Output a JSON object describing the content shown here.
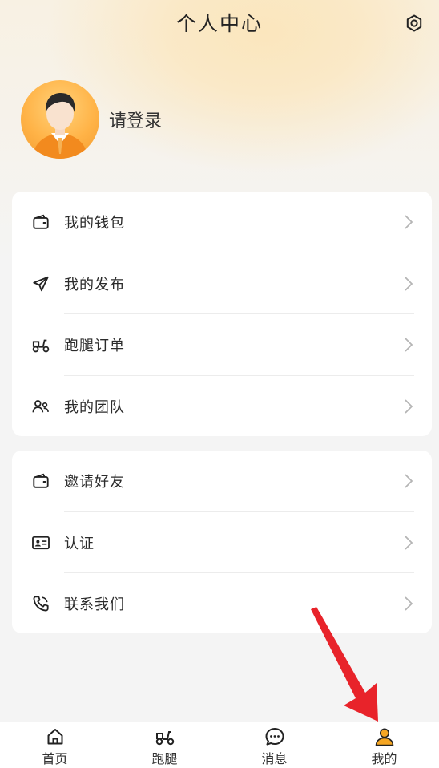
{
  "header": {
    "title": "个人中心",
    "settings_icon": "settings-icon"
  },
  "profile": {
    "login_text": "请登录",
    "avatar_icon": "user-avatar"
  },
  "menu_group1": [
    {
      "label": "我的钱包",
      "icon": "wallet-icon"
    },
    {
      "label": "我的发布",
      "icon": "send-icon"
    },
    {
      "label": "跑腿订单",
      "icon": "scooter-icon"
    },
    {
      "label": "我的团队",
      "icon": "team-icon"
    }
  ],
  "menu_group2": [
    {
      "label": "邀请好友",
      "icon": "wallet-icon"
    },
    {
      "label": "认证",
      "icon": "id-card-icon"
    },
    {
      "label": "联系我们",
      "icon": "phone-icon"
    }
  ],
  "tabbar": [
    {
      "label": "首页",
      "icon": "home-icon",
      "active": false
    },
    {
      "label": "跑腿",
      "icon": "scooter-icon",
      "active": false
    },
    {
      "label": "消息",
      "icon": "message-icon",
      "active": false
    },
    {
      "label": "我的",
      "icon": "user-icon",
      "active": true
    }
  ],
  "colors": {
    "accent": "#f5a623",
    "annotation_arrow": "#e8232a",
    "background": "#f4f4f4"
  }
}
